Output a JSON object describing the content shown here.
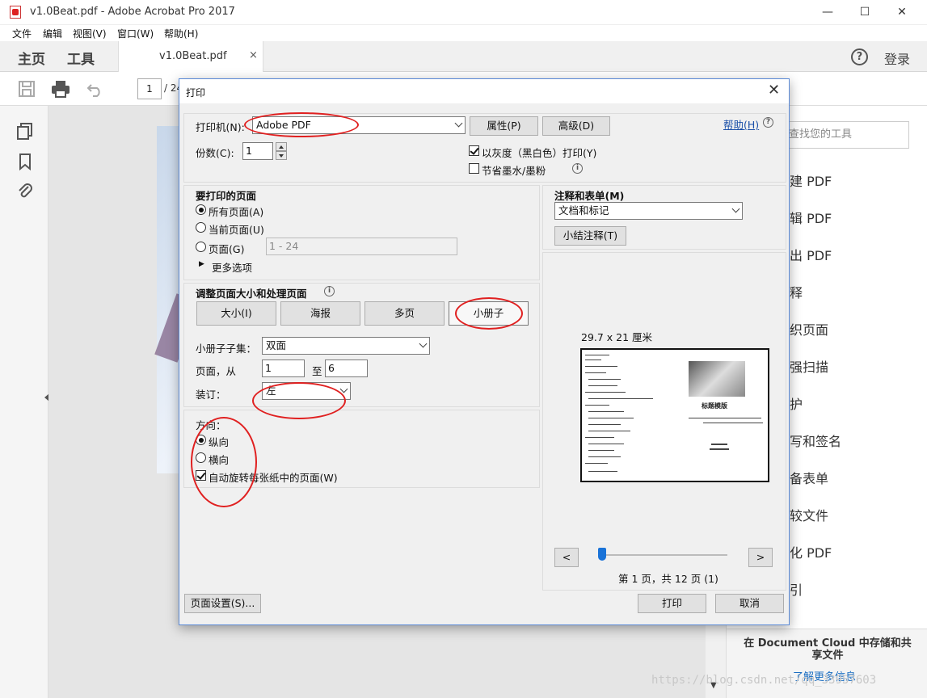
{
  "window": {
    "title": "v1.0Beat.pdf - Adobe Acrobat Pro 2017",
    "controls": [
      "—",
      "☐",
      "✕"
    ]
  },
  "menu": [
    "文件",
    "编辑",
    "视图(V)",
    "窗口(W)",
    "帮助(H)"
  ],
  "tabs": {
    "home": "主页",
    "tools": "工具",
    "doc_tab": "v1.0Beat.pdf",
    "doc_close": "×",
    "help": "?",
    "login": "登录"
  },
  "toolbar": {
    "page_current": "1",
    "page_sep": "/ 24"
  },
  "right_panel": {
    "search_placeholder": "查找您的工具",
    "items": [
      "建 PDF",
      "辑 PDF",
      "出 PDF",
      "释",
      "织页面",
      "强扫描",
      "护",
      "写和签名",
      "备表单",
      "较文件",
      "化 PDF",
      "引"
    ],
    "promo_title": "在 Document Cloud 中存储和共享文件",
    "promo_link": "了解更多信息",
    "scroll_down": "▼"
  },
  "watermark": "https://blog.csdn.net/qq_33957603",
  "dialog": {
    "title": "打印",
    "close": "✕",
    "printer_label": "打印机(N):",
    "printer_value": "Adobe PDF",
    "properties_btn": "属性(P)",
    "advanced_btn": "高级(D)",
    "help_link": "帮助(H)",
    "help_icon": "?",
    "copies_label": "份数(C):",
    "copies_value": "1",
    "grayscale_label": "以灰度（黑白色）打印(Y)",
    "grayscale_checked": true,
    "save_ink_label": "节省墨水/墨粉",
    "save_ink_checked": false,
    "info_icon": "i",
    "pages_section": "要打印的页面",
    "all_pages": "所有页面(A)",
    "current_page": "当前页面(U)",
    "pages_opt": "页面(G)",
    "pages_range": "1 - 24",
    "more_options": "更多选项",
    "more_options_icon": "▶",
    "sizing_section": "调整页面大小和处理页面",
    "size_btn": "大小(I)",
    "poster_btn": "海报",
    "multi_btn": "多页",
    "booklet_btn": "小册子",
    "booklet_set_label": "小册子子集：",
    "booklet_set_value": "双面",
    "pages_from_label": "页面，从",
    "pages_from_value": "1",
    "to_label": "至",
    "pages_to_value": "6",
    "binding_label": "装订：",
    "binding_value": "左",
    "orientation_label": "方向：",
    "portrait": "纵向",
    "landscape": "横向",
    "auto_rotate": "自动旋转每张纸中的页面(W)",
    "comments_section": "注释和表单(M)",
    "comments_value": "文档和标记",
    "summarize_btn": "小结注释(T)",
    "paper_size": "29.7 x 21 厘米",
    "preview_title": "标题模版",
    "prev_btn": "<",
    "next_btn": ">",
    "page_status": "第 1 页，共 12 页 (1)",
    "page_setup_btn": "页面设置(S)...",
    "print_btn": "打印",
    "cancel_btn": "取消"
  },
  "colors": {
    "annotation": "#e02020",
    "dialog_border": "#5b8ad6",
    "link": "#1a6dc1"
  }
}
